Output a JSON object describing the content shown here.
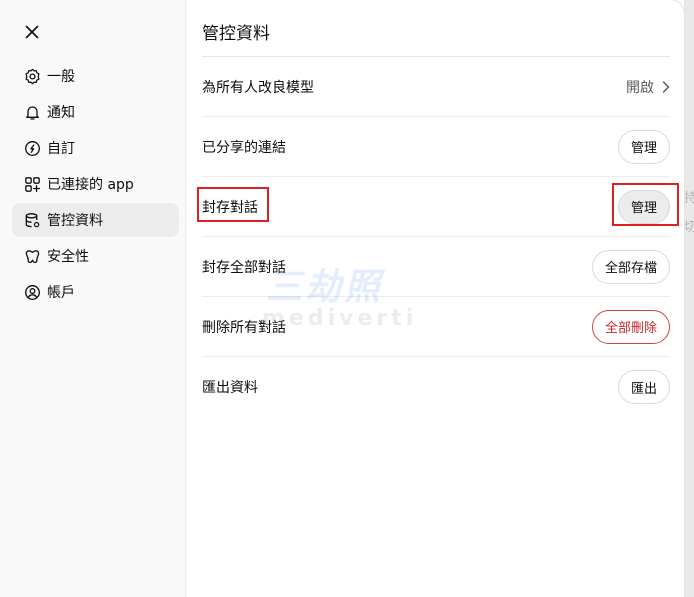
{
  "sidebar": {
    "items": [
      {
        "label": "一般",
        "icon": "gear-icon"
      },
      {
        "label": "通知",
        "icon": "bell-icon"
      },
      {
        "label": "自訂",
        "icon": "personalize-icon"
      },
      {
        "label": "已連接的 app",
        "icon": "connected-apps-icon"
      },
      {
        "label": "管控資料",
        "icon": "database-icon",
        "active": true
      },
      {
        "label": "安全性",
        "icon": "security-icon"
      },
      {
        "label": "帳戶",
        "icon": "account-icon"
      }
    ]
  },
  "main": {
    "title": "管控資料",
    "rows": [
      {
        "label": "為所有人改良模型",
        "value": "開啟"
      },
      {
        "label": "已分享的連結",
        "button": "管理"
      },
      {
        "label": "封存對話",
        "button": "管理"
      },
      {
        "label": "封存全部對話",
        "button": "全部存檔"
      },
      {
        "label": "刪除所有對話",
        "button": "全部刪除"
      },
      {
        "label": "匯出資料",
        "button": "匯出"
      }
    ]
  },
  "colors": {
    "sidebar_bg": "#f9f9f9",
    "active_item_bg": "#ececec",
    "danger": "#c62828",
    "annotation": "#e02020"
  },
  "watermark": {
    "line1": "三劫照",
    "line2": "mediverti"
  },
  "backdrop": {
    "ghost_texts": [
      "持",
      "切"
    ]
  }
}
